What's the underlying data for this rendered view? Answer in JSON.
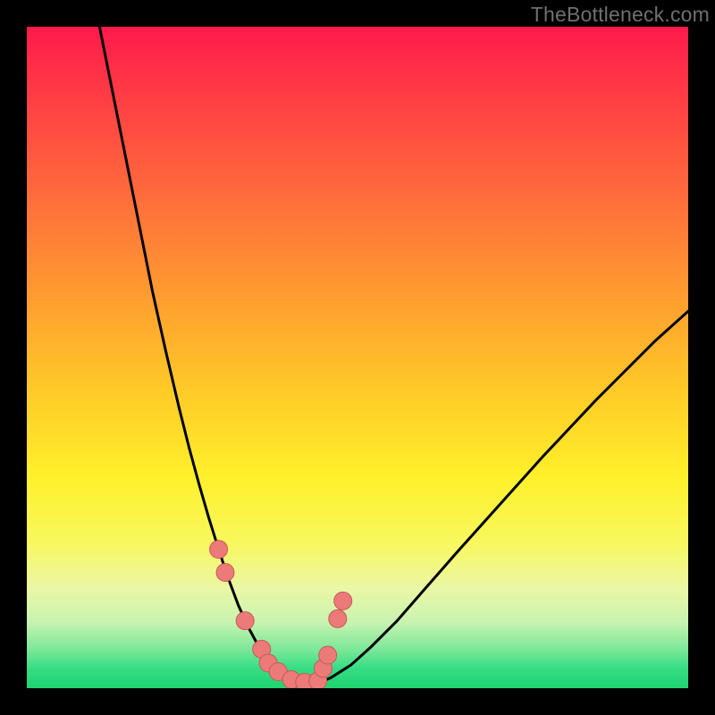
{
  "watermark": "TheBottleneck.com",
  "colors": {
    "frame": "#000000",
    "gradient_top": "#ff1a4b",
    "gradient_bottom": "#1ed36f",
    "curve": "#000000",
    "marker_fill": "#ec7a78",
    "marker_stroke": "#c85a58"
  },
  "chart_data": {
    "type": "line",
    "title": "",
    "xlabel": "",
    "ylabel": "",
    "xlim": [
      0,
      100
    ],
    "ylim": [
      0,
      100
    ],
    "series": [
      {
        "name": "bottleneck-curve",
        "x": [
          11,
          13,
          15,
          17,
          19,
          21,
          23,
          24.5,
          26,
          27.5,
          29,
          30.5,
          32,
          33.5,
          35,
          36.5,
          38,
          40,
          42,
          44,
          46,
          49,
          52,
          56,
          60,
          65,
          71,
          78,
          86,
          95,
          100
        ],
        "values": [
          100,
          90,
          80,
          70,
          60,
          51,
          42.5,
          36.5,
          31,
          25.8,
          21,
          16.5,
          12.5,
          9.2,
          6.4,
          4.2,
          2.7,
          1.4,
          0.7,
          0.7,
          1.6,
          3.5,
          6.2,
          10.2,
          14.8,
          20.5,
          27.2,
          35,
          43.5,
          52.5,
          57
        ]
      }
    ],
    "markers": [
      {
        "x": 29.0,
        "y": 21.0
      },
      {
        "x": 30.0,
        "y": 17.5
      },
      {
        "x": 33.0,
        "y": 10.2
      },
      {
        "x": 35.5,
        "y": 5.9
      },
      {
        "x": 36.5,
        "y": 3.8
      },
      {
        "x": 38.0,
        "y": 2.5
      },
      {
        "x": 40.0,
        "y": 1.3
      },
      {
        "x": 42.0,
        "y": 0.9
      },
      {
        "x": 44.0,
        "y": 1.1
      },
      {
        "x": 44.8,
        "y": 3.0
      },
      {
        "x": 45.5,
        "y": 5.0
      },
      {
        "x": 47.0,
        "y": 10.5
      },
      {
        "x": 47.8,
        "y": 13.2
      }
    ]
  }
}
